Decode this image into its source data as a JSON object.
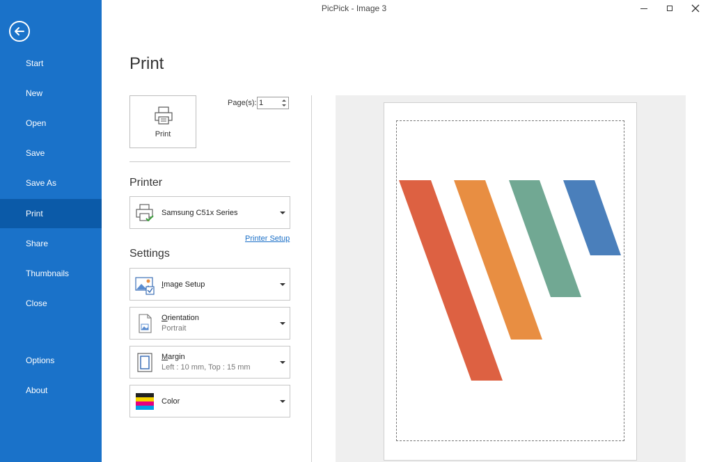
{
  "window": {
    "title": "PicPick - Image 3",
    "minimize_icon": "minimize-icon",
    "maximize_icon": "maximize-icon",
    "close_icon": "close-icon"
  },
  "sidebar": {
    "back_icon": "back-arrow-icon",
    "accent_color": "#1a72c9",
    "active_color": "#0b5aa8",
    "items": [
      {
        "label": "Start"
      },
      {
        "label": "New"
      },
      {
        "label": "Open"
      },
      {
        "label": "Save"
      },
      {
        "label": "Save As"
      },
      {
        "label": "Print",
        "active": true
      },
      {
        "label": "Share"
      },
      {
        "label": "Thumbnails"
      },
      {
        "label": "Close"
      },
      {
        "label": "Options"
      },
      {
        "label": "About"
      }
    ]
  },
  "main": {
    "title": "Print",
    "print_button": {
      "label": "Print",
      "icon": "printer-icon"
    },
    "pages": {
      "label": "Page(s):",
      "value": "1"
    },
    "printer": {
      "section_title": "Printer",
      "selected": "Samsung C51x Series",
      "icon": "printer-ready-icon",
      "setup_link": "Printer Setup"
    },
    "settings": {
      "section_title": "Settings",
      "image_setup": {
        "label_first": "I",
        "label_rest": "mage Setup",
        "icon": "image-setup-icon"
      },
      "orientation": {
        "label_first": "O",
        "label_rest": "rientation",
        "value": "Portrait",
        "icon": "portrait-page-icon"
      },
      "margin": {
        "label_first": "M",
        "label_rest": "argin",
        "value": "Left : 10 mm, Top : 15 mm",
        "icon": "margin-icon"
      },
      "color": {
        "label": "Color",
        "icon": "color-bars-icon"
      }
    }
  },
  "preview": {
    "logo_colors": [
      "#dd6142",
      "#e88e42",
      "#71a893",
      "#4a7fbb"
    ]
  }
}
